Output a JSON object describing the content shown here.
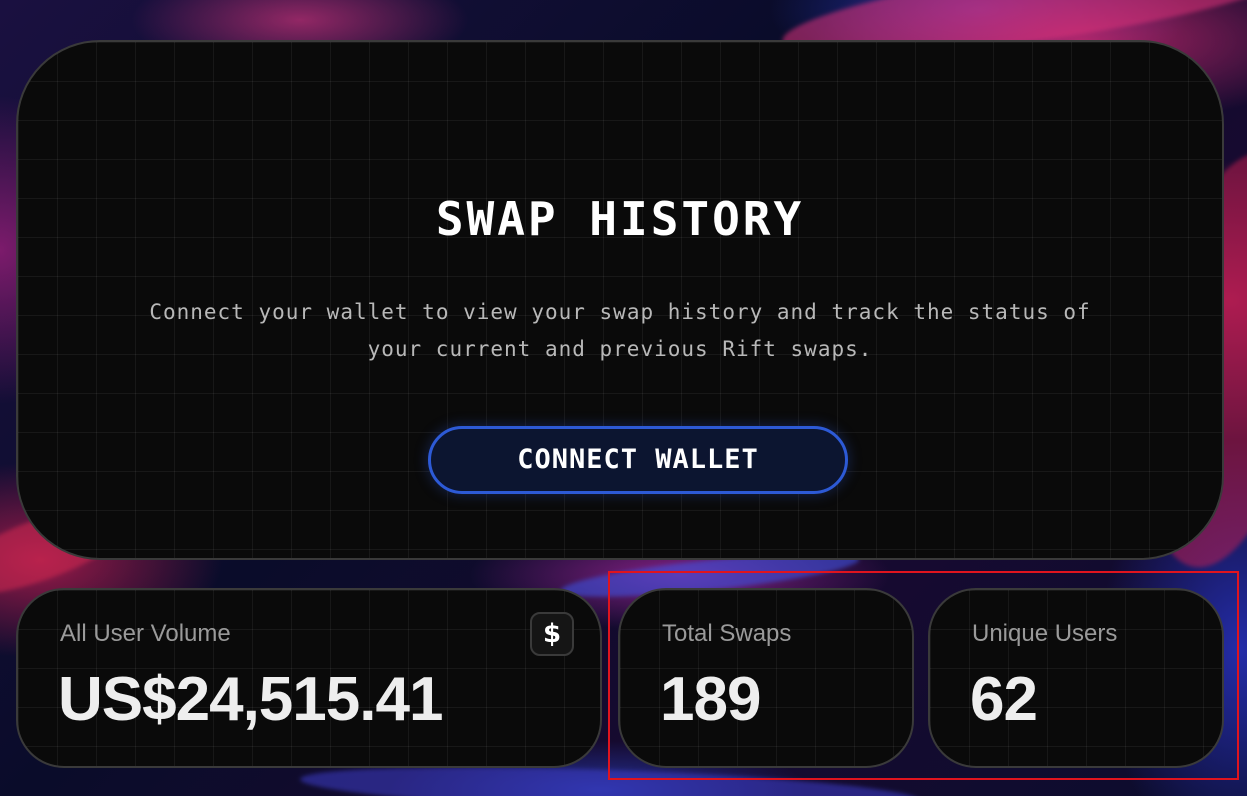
{
  "hero": {
    "title": "SWAP HISTORY",
    "description": "Connect your wallet to view your swap history and track the status of your current and previous Rift swaps.",
    "connect_button": "CONNECT WALLET"
  },
  "stats": {
    "volume": {
      "label": "All User Volume",
      "value": "US$24,515.41",
      "icon": "dollar-icon",
      "icon_glyph": "$"
    },
    "swaps": {
      "label": "Total Swaps",
      "value": "189"
    },
    "users": {
      "label": "Unique Users",
      "value": "62"
    }
  },
  "colors": {
    "accent_blue": "#2d5ad6",
    "highlight_red": "#e0141e",
    "panel_bg": "#0a0a0a"
  }
}
